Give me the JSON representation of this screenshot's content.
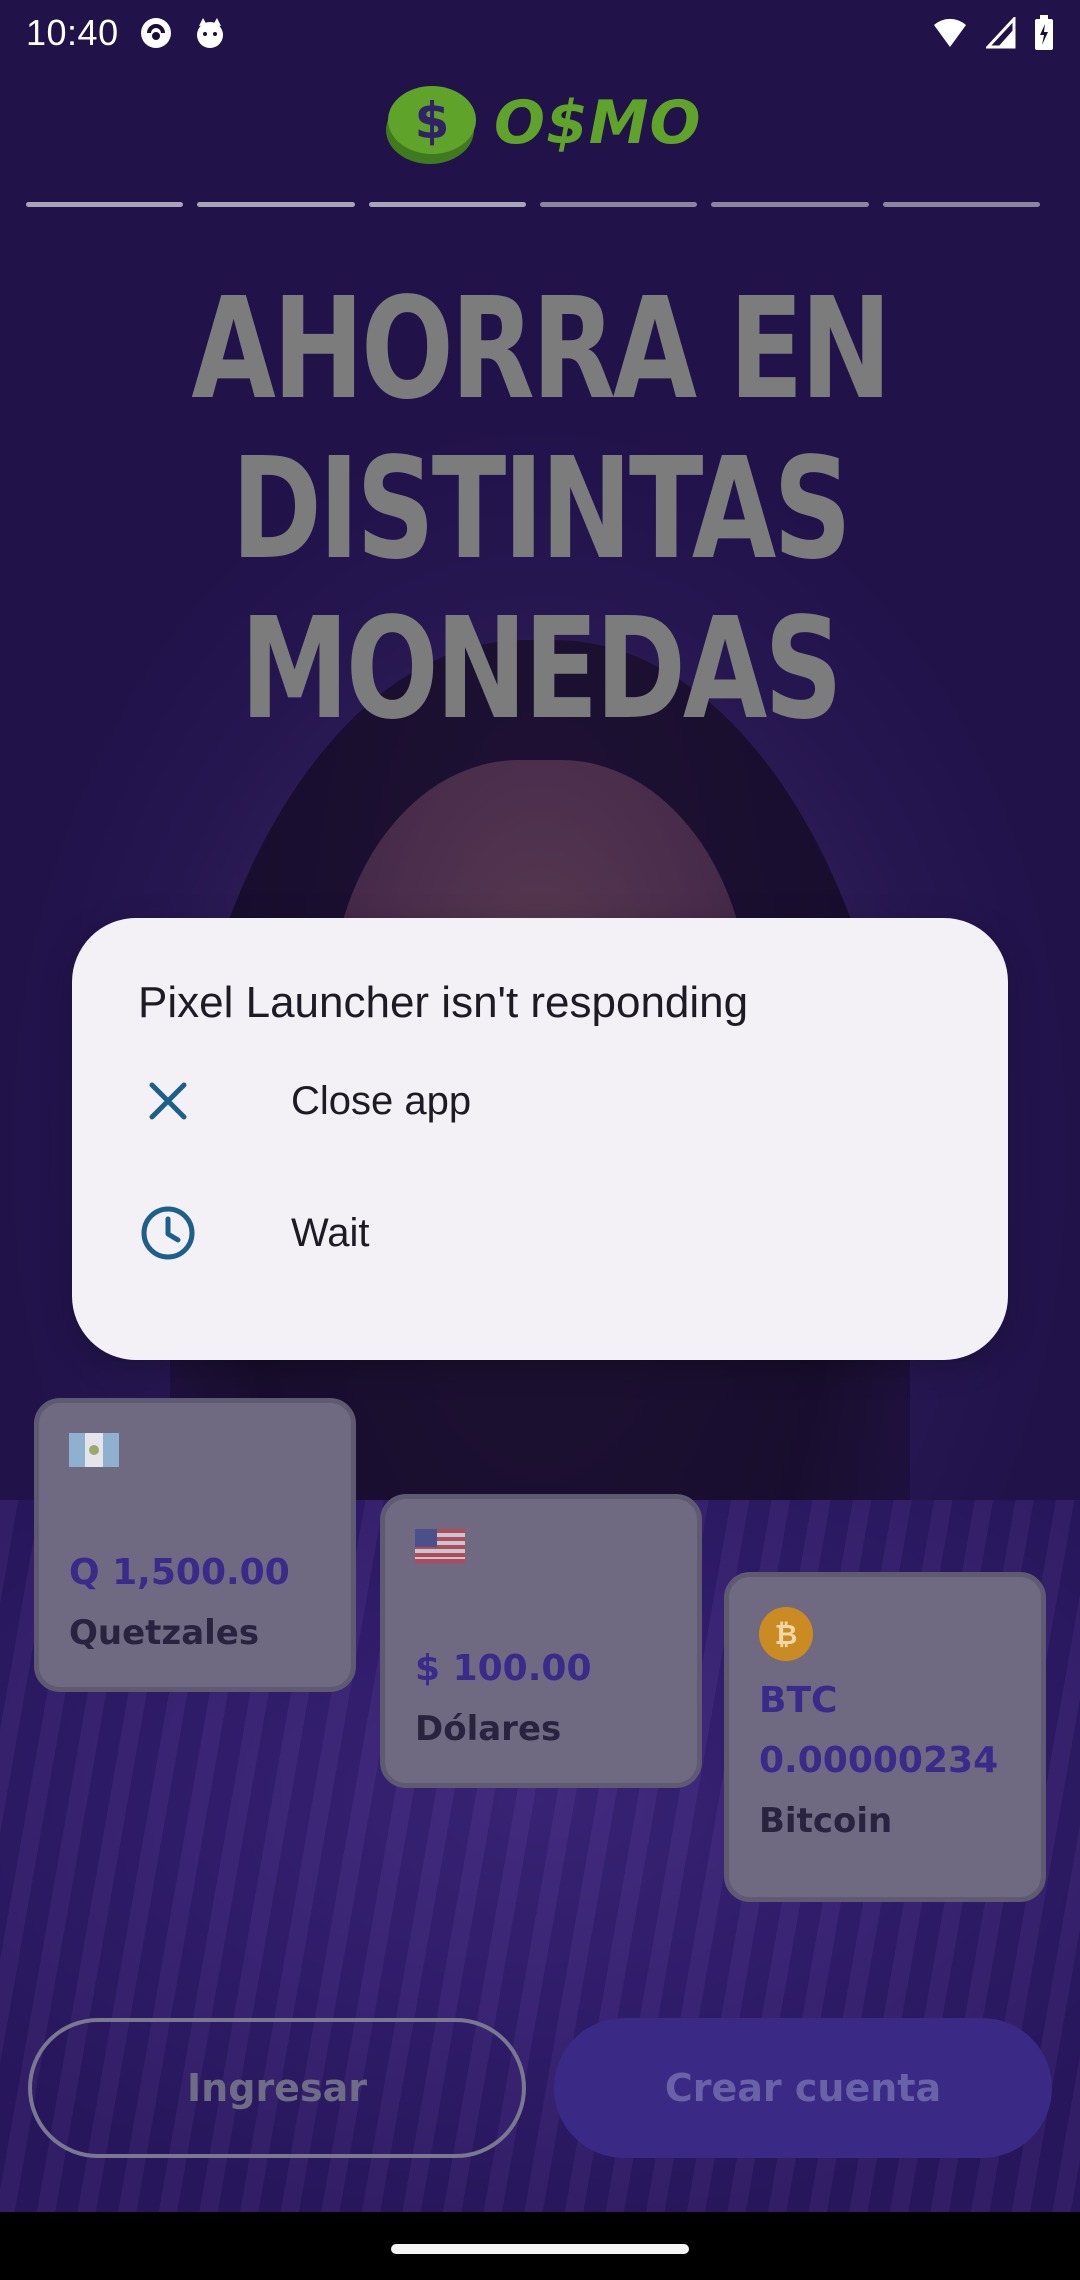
{
  "status_bar": {
    "time": "10:40",
    "icons": [
      "app-notification-icon",
      "cat-notification-icon",
      "wifi-icon",
      "signal-icon",
      "battery-icon"
    ]
  },
  "app": {
    "logo_text": "O$MO",
    "headline": [
      "AHORRA EN",
      "DISTINTAS",
      "MONEDAS"
    ],
    "onboarding_steps_total": 6,
    "onboarding_steps_active": 3,
    "cards": [
      {
        "flag": "guatemala-flag-icon",
        "amount": "Q 1,500.00",
        "name": "Quetzales"
      },
      {
        "flag": "usa-flag-icon",
        "amount": "$ 100.00",
        "name": "Dólares"
      },
      {
        "flag": "bitcoin-icon",
        "amount_line1": "BTC",
        "amount_line2": "0.00000234",
        "name": "Bitcoin"
      }
    ],
    "login_label": "Ingresar",
    "signup_label": "Crear cuenta"
  },
  "dialog": {
    "title": "Pixel Launcher isn't responding",
    "close_label": "Close app",
    "wait_label": "Wait",
    "accent": "#1b5f8a"
  }
}
